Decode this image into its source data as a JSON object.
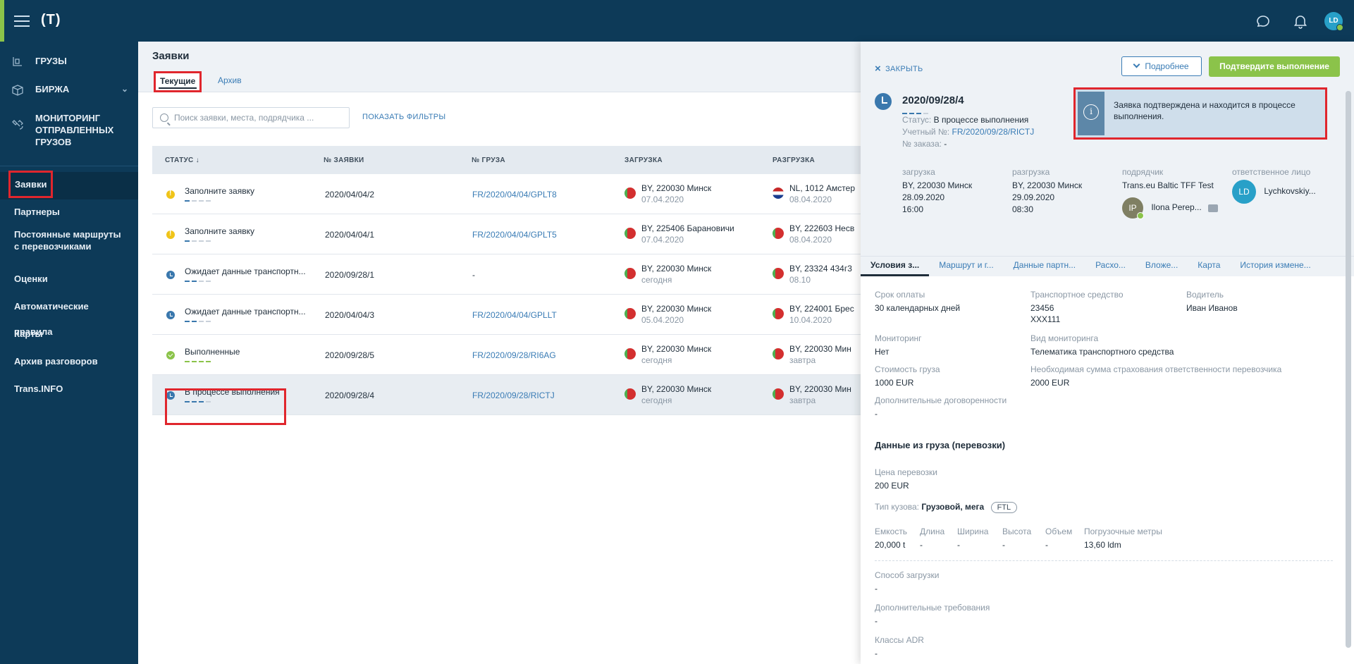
{
  "topbar": {
    "logo": "(T)"
  },
  "sidebar": {
    "main_items": [
      {
        "label": "ГРУЗЫ"
      },
      {
        "label": "БИРЖА"
      },
      {
        "label": "МОНИТОРИНГ ОТПРАВЛЕННЫХ ГРУЗОВ"
      }
    ],
    "items": [
      {
        "label": "Заявки"
      },
      {
        "label": "Партнеры"
      },
      {
        "label": "Постоянные маршруты с перевозчиками"
      },
      {
        "label": "Оценки"
      },
      {
        "label": "Автоматические правила"
      },
      {
        "label": "Карты"
      },
      {
        "label": "Архив разговоров"
      },
      {
        "label": "Trans.INFO"
      }
    ]
  },
  "main": {
    "title": "Заявки",
    "tabs": [
      {
        "label": "Текущие"
      },
      {
        "label": "Архив"
      }
    ],
    "search_placeholder": "Поиск заявки, места, подрядчика ...",
    "show_filters": "ПОКАЗАТЬ ФИЛЬТРЫ",
    "columns": [
      "СТАТУС ↓",
      "№ ЗАЯВКИ",
      "№ ГРУЗА",
      "ЗАГРУЗКА",
      "РАЗГРУЗКА"
    ],
    "rows": [
      {
        "status": "Заполните заявку",
        "num": "2020/04/04/2",
        "cargo": "FR/2020/04/04/GPLT8",
        "load_city": "BY, 220030 Минск",
        "load_date": "07.04.2020",
        "unload_city": "NL, 1012 Амстер",
        "unload_date": "08.04.2020"
      },
      {
        "status": "Заполните заявку",
        "num": "2020/04/04/1",
        "cargo": "FR/2020/04/04/GPLT5",
        "load_city": "BY, 225406 Барановичи",
        "load_date": "07.04.2020",
        "unload_city": "BY, 222603 Несв",
        "unload_date": "08.04.2020"
      },
      {
        "status": "Ожидает данные транспортн...",
        "num": "2020/09/28/1",
        "cargo": "-",
        "load_city": "BY, 220030 Минск",
        "load_date": "сегодня",
        "unload_city": "BY, 23324 434г3",
        "unload_date": "08.10"
      },
      {
        "status": "Ожидает данные транспортн...",
        "num": "2020/04/04/3",
        "cargo": "FR/2020/04/04/GPLLT",
        "load_city": "BY, 220030 Минск",
        "load_date": "05.04.2020",
        "unload_city": "BY, 224001 Брес",
        "unload_date": "10.04.2020"
      },
      {
        "status": "Выполненные",
        "num": "2020/09/28/5",
        "cargo": "FR/2020/09/28/RI6AG",
        "load_city": "BY, 220030 Минск",
        "load_date": "сегодня",
        "unload_city": "BY, 220030 Мин",
        "unload_date": "завтра"
      },
      {
        "status": "В процессе выполнения",
        "num": "2020/09/28/4",
        "cargo": "FR/2020/09/28/RICTJ",
        "load_city": "BY, 220030 Минск",
        "load_date": "сегодня",
        "unload_city": "BY, 220030 Мин",
        "unload_date": "завтра"
      }
    ]
  },
  "panel": {
    "close": "ЗАКРЫТЬ",
    "more": "Подробнее",
    "confirm": "Подтвердите выполнение",
    "order_num": "2020/09/28/4",
    "status_label": "Статус:",
    "status_value": "В процессе выполнения",
    "account_label": "Учетный №:",
    "account_value": "FR/2020/09/28/RICTJ",
    "order_label": "№ заказа:",
    "order_value": "-",
    "info_text": "Заявка подтверждена и находится в процессе выполнения.",
    "load": {
      "label": "загрузка",
      "city": "BY, 220030 Минск",
      "date": "28.09.2020",
      "time": "16:00"
    },
    "unload": {
      "label": "разгрузка",
      "city": "BY, 220030 Минск",
      "date": "29.09.2020",
      "time": "08:30"
    },
    "contractor": {
      "label": "подрядчик",
      "company": "Trans.eu Baltic TFF Test",
      "initials": "IP",
      "person": "Ilona Perep..."
    },
    "responsible": {
      "label": "ответственное лицо",
      "initials": "LD",
      "person": "Lychkovskiy..."
    },
    "tabs": [
      "Условия з...",
      "Маршрут и г...",
      "Данные партн...",
      "Расхо...",
      "Вложе...",
      "Карта",
      "История измене..."
    ],
    "fields": {
      "payment_label": "Срок оплаты",
      "payment_value": "30 календарных дней",
      "vehicle_label": "Транспортное средство",
      "vehicle_value1": "23456",
      "vehicle_value2": "XXX111",
      "driver_label": "Водитель",
      "driver_value": "Иван Иванов",
      "monitoring_label": "Мониторинг",
      "monitoring_value": "Нет",
      "monitoring_type_label": "Вид мониторинга",
      "monitoring_type_value": "Телематика транспортного средства",
      "cargo_cost_label": "Стоимость груза",
      "cargo_cost_value": "1000 EUR",
      "insurance_label": "Необходимая сумма страхования ответственности перевозчика",
      "insurance_value": "2000 EUR",
      "extra_label": "Дополнительные договоренности",
      "extra_value": "-"
    },
    "cargo_section": {
      "title": "Данные из груза (перевозки)",
      "price_label": "Цена перевозки",
      "price_value": "200 EUR",
      "body_label": "Тип кузова:",
      "body_value": "Грузовой, мега",
      "body_badge": "FTL",
      "capacity_label": "Емкость",
      "capacity_value": "20,000 t",
      "length_label": "Длина",
      "length_value": "-",
      "width_label": "Ширина",
      "width_value": "-",
      "height_label": "Высота",
      "height_value": "-",
      "volume_label": "Объем",
      "volume_value": "-",
      "ldm_label": "Погрузочные метры",
      "ldm_value": "13,60 ldm",
      "loading_method_label": "Способ загрузки",
      "loading_method_value": "-",
      "requirements_label": "Дополнительные требования",
      "requirements_value": "-",
      "adr_label": "Классы ADR",
      "adr_value": "-"
    }
  }
}
